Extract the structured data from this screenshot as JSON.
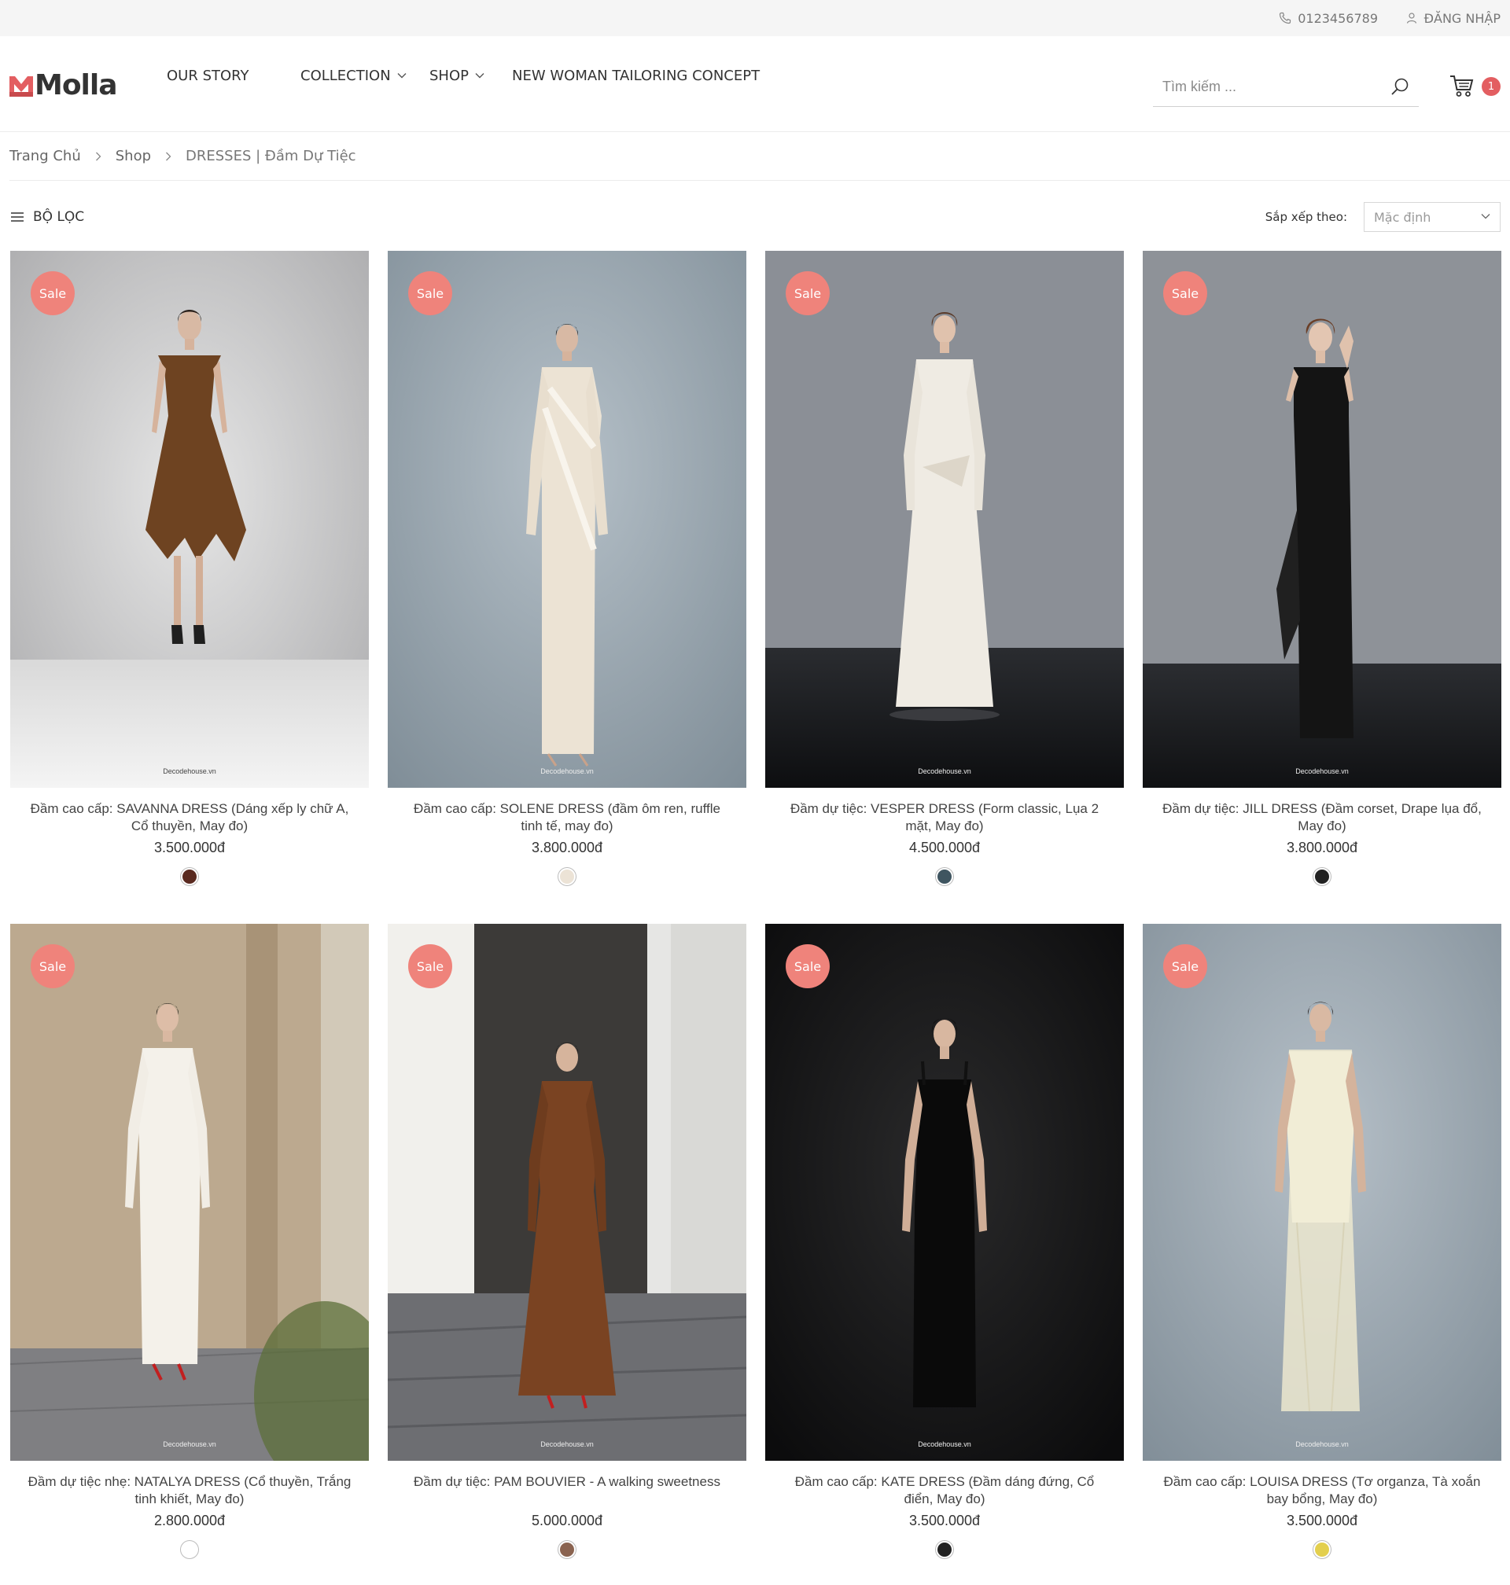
{
  "topbar": {
    "phone": "0123456789",
    "login": "ĐĂNG NHẬP"
  },
  "header": {
    "logo": "Molla",
    "nav": [
      {
        "label": "OUR STORY",
        "dropdown": false
      },
      {
        "label": "COLLECTION",
        "dropdown": true
      },
      {
        "label": "SHOP",
        "dropdown": true
      },
      {
        "label": "NEW WOMAN TAILORING CONCEPT",
        "dropdown": false
      }
    ],
    "search_placeholder": "Tìm kiếm ...",
    "cart_count": "1"
  },
  "breadcrumb": [
    "Trang Chủ",
    "Shop",
    "DRESSES | Đầm Dự Tiệc"
  ],
  "toolbar": {
    "filter_label": "BỘ LỌC",
    "sort_label": "Sắp xếp theo:",
    "sort_value": "Mặc định"
  },
  "colors": {
    "accent": "#ef837b",
    "cart_badge": "#e35e61"
  },
  "products": [
    {
      "badge": "Sale",
      "title": "Đầm cao cấp: SAVANNA DRESS (Dáng xếp ly chữ A, Cổ thuyền, May đo)",
      "price": "3.500.000đ",
      "swatch": "#5a2a20",
      "watermark": "Decodehouse.vn"
    },
    {
      "badge": "Sale",
      "title": "Đầm cao cấp: SOLENE DRESS (đầm ôm ren, ruffle tinh tế, may đo)",
      "price": "3.800.000đ",
      "swatch": "#ece3d6",
      "watermark": "Decodehouse.vn"
    },
    {
      "badge": "Sale",
      "title": "Đầm dự tiệc: VESPER DRESS (Form classic, Lụa 2 mặt, May đo)",
      "price": "4.500.000đ",
      "swatch": "#3f5560",
      "watermark": "Decodehouse.vn"
    },
    {
      "badge": "Sale",
      "title": "Đầm dự tiệc: JILL DRESS (Đầm corset, Drape lụa đổ, May đo)",
      "price": "3.800.000đ",
      "swatch": "#222222",
      "watermark": "Decodehouse.vn"
    },
    {
      "badge": "Sale",
      "title": "Đầm dự tiệc nhẹ: NATALYA DRESS (Cổ thuyền, Trắng tinh khiết, May đo)",
      "price": "2.800.000đ",
      "swatch": "#ffffff",
      "watermark": "Decodehouse.vn"
    },
    {
      "badge": "Sale",
      "title": "Đầm dự tiệc: PAM BOUVIER - A walking sweetness",
      "price": "5.000.000đ",
      "swatch": "#8a6350",
      "watermark": "Decodehouse.vn"
    },
    {
      "badge": "Sale",
      "title": "Đầm cao cấp: KATE DRESS (Đầm dáng đứng, Cổ điển, May đo)",
      "price": "3.500.000đ",
      "swatch": "#222222",
      "watermark": "Decodehouse.vn"
    },
    {
      "badge": "Sale",
      "title": "Đầm cao cấp: LOUISA DRESS (Tơ organza, Tà xoắn bay bổng, May đo)",
      "price": "3.500.000đ",
      "swatch": "#e3cf4e",
      "watermark": "Decodehouse.vn"
    }
  ]
}
